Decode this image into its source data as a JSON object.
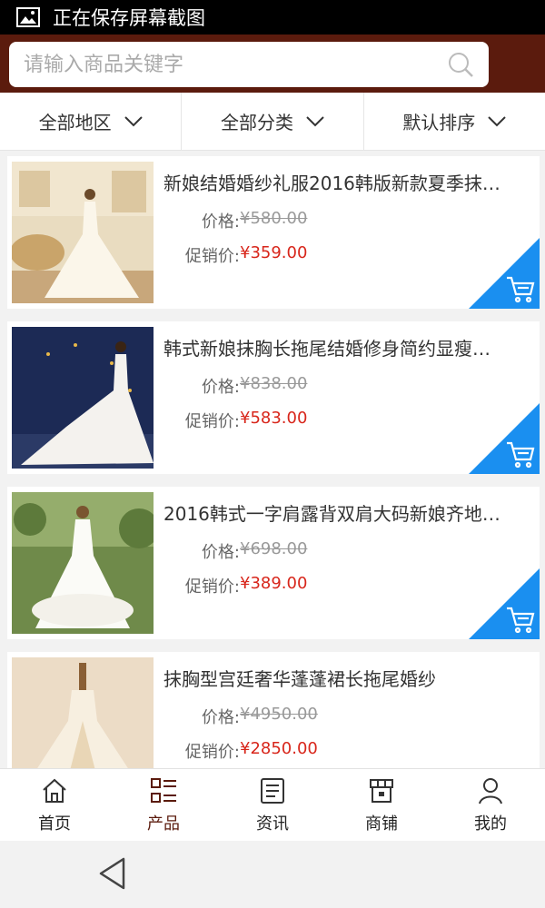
{
  "status": {
    "text": "正在保存屏幕截图"
  },
  "search": {
    "placeholder": "请输入商品关键字"
  },
  "filters": [
    {
      "label": "全部地区"
    },
    {
      "label": "全部分类"
    },
    {
      "label": "默认排序"
    }
  ],
  "labels": {
    "price": "价格:",
    "promo": "促销价:"
  },
  "products": [
    {
      "title": "新娘结婚婚纱礼服2016韩版新款夏季抹…",
      "price": "¥580.00",
      "promo": "¥359.00"
    },
    {
      "title": "韩式新娘抹胸长拖尾结婚修身简约显瘦…",
      "price": "¥838.00",
      "promo": "¥583.00"
    },
    {
      "title": "2016韩式一字肩露背双肩大码新娘齐地…",
      "price": "¥698.00",
      "promo": "¥389.00"
    },
    {
      "title": "抹胸型宫廷奢华蓬蓬裙长拖尾婚纱",
      "price": "¥4950.00",
      "promo": "¥2850.00"
    }
  ],
  "tabs": [
    {
      "label": "首页",
      "icon": "home-icon"
    },
    {
      "label": "产品",
      "icon": "grid-list-icon",
      "active": true
    },
    {
      "label": "资讯",
      "icon": "news-icon"
    },
    {
      "label": "商铺",
      "icon": "shop-icon"
    },
    {
      "label": "我的",
      "icon": "user-icon"
    }
  ],
  "colors": {
    "header": "#5b1b0d",
    "promo_price": "#d8261b",
    "cart_badge": "#1a8ff0",
    "active_tab": "#5b1b0d"
  }
}
